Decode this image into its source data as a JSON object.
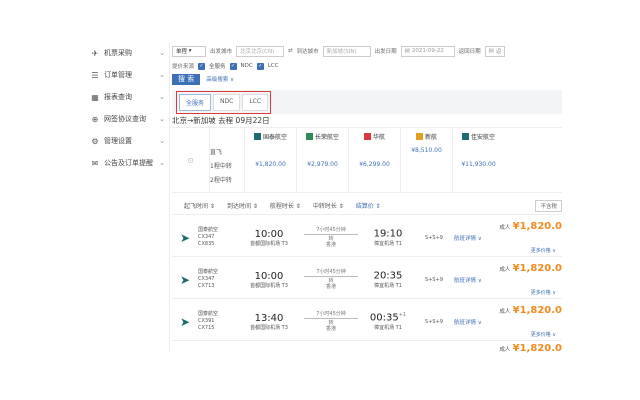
{
  "sidebar": {
    "items": [
      {
        "icon": "airplane-icon",
        "glyph": "✈",
        "label": "机票采购"
      },
      {
        "icon": "list-icon",
        "glyph": "☰",
        "label": "订单管理"
      },
      {
        "icon": "report-icon",
        "glyph": "▦",
        "label": "报表查询"
      },
      {
        "icon": "network-icon",
        "glyph": "⊕",
        "label": "网签协议查询"
      },
      {
        "icon": "gear-icon",
        "glyph": "⚙",
        "label": "管理设置"
      },
      {
        "icon": "megaphone-icon",
        "glyph": "✉",
        "label": "公告及订单提醒"
      }
    ]
  },
  "search": {
    "trip_type": "单程",
    "from_label": "出发城市",
    "from_value": "北京北京(CN)",
    "to_label": "到达城市",
    "to_value": "新加坡(SIN)",
    "depart_label": "出发日期",
    "depart_value": "2021-09-22",
    "return_label": "返回日期",
    "return_value": "返",
    "supplier_label": "提价来源",
    "checks": [
      "全服务",
      "NDC",
      "LCC"
    ],
    "search_button": "搜 索",
    "advanced_label": "高级搜索 ∨"
  },
  "tabs": [
    "全服务",
    "NDC",
    "LCC"
  ],
  "route": "北京→新加坡  去程 09月22日",
  "matrix": {
    "row_labels": [
      "直飞",
      "1程中转",
      "2程中转"
    ],
    "airlines": [
      {
        "name": "国泰航空",
        "color": "#1b6b6f",
        "direct": "",
        "one_stop": "¥1,820.00",
        "two_stop": ""
      },
      {
        "name": "长荣航空",
        "color": "#2e8b57",
        "direct": "",
        "one_stop": "¥2,979.00",
        "two_stop": ""
      },
      {
        "name": "华航",
        "color": "#d9393f",
        "direct": "",
        "one_stop": "¥6,299.00",
        "two_stop": ""
      },
      {
        "name": "新航",
        "color": "#e0a020",
        "direct": "¥8,510.00",
        "one_stop": "",
        "two_stop": ""
      },
      {
        "name": "佳安航空",
        "color": "#1b6b6f",
        "direct": "",
        "one_stop": "¥11,930.00",
        "two_stop": ""
      }
    ]
  },
  "sortbar": {
    "items": [
      "起飞时间 ⇕",
      "到达时间 ⇕",
      "航程时长 ⇕",
      "中转时长 ⇕",
      "结算价 ⇕"
    ],
    "tax_label": "不含税"
  },
  "flights": [
    {
      "airline": "国泰航空",
      "codes": [
        "CX347",
        "CX835"
      ],
      "dep_time": "10:00",
      "dep_apt": "首都国际机场 T3",
      "duration": "7小时45分钟",
      "stop": "转",
      "via": "香港",
      "arr_time": "19:10",
      "arr_plus": "",
      "arr_apt": "樟宜机场 T1",
      "bag": "S+S+9",
      "detail": "航班详情 ∨",
      "adult": "成人",
      "price": "¥1,820.0",
      "more": "更多价格 ∨"
    },
    {
      "airline": "国泰航空",
      "codes": [
        "CX347",
        "CX713"
      ],
      "dep_time": "10:00",
      "dep_apt": "首都国际机场 T3",
      "duration": "7小时45分钟",
      "stop": "转",
      "via": "香港",
      "arr_time": "20:35",
      "arr_plus": "",
      "arr_apt": "樟宜机场 T1",
      "bag": "S+S+9",
      "detail": "航班详情 ∨",
      "adult": "成人",
      "price": "¥1,820.0",
      "more": "更多价格 ∨"
    },
    {
      "airline": "国泰航空",
      "codes": [
        "CX391",
        "CX715"
      ],
      "dep_time": "13:40",
      "dep_apt": "首都国际机场 T3",
      "duration": "7小时45分钟",
      "stop": "转",
      "via": "香港",
      "arr_time": "00:35",
      "arr_plus": "+1",
      "arr_apt": "樟宜机场 T1",
      "bag": "S+S+9",
      "detail": "航班详情 ∨",
      "adult": "成人",
      "price": "¥1,820.0",
      "more": "更多价格 ∨"
    }
  ],
  "footer_price": {
    "adult": "成人",
    "price": "¥1,820.0"
  }
}
